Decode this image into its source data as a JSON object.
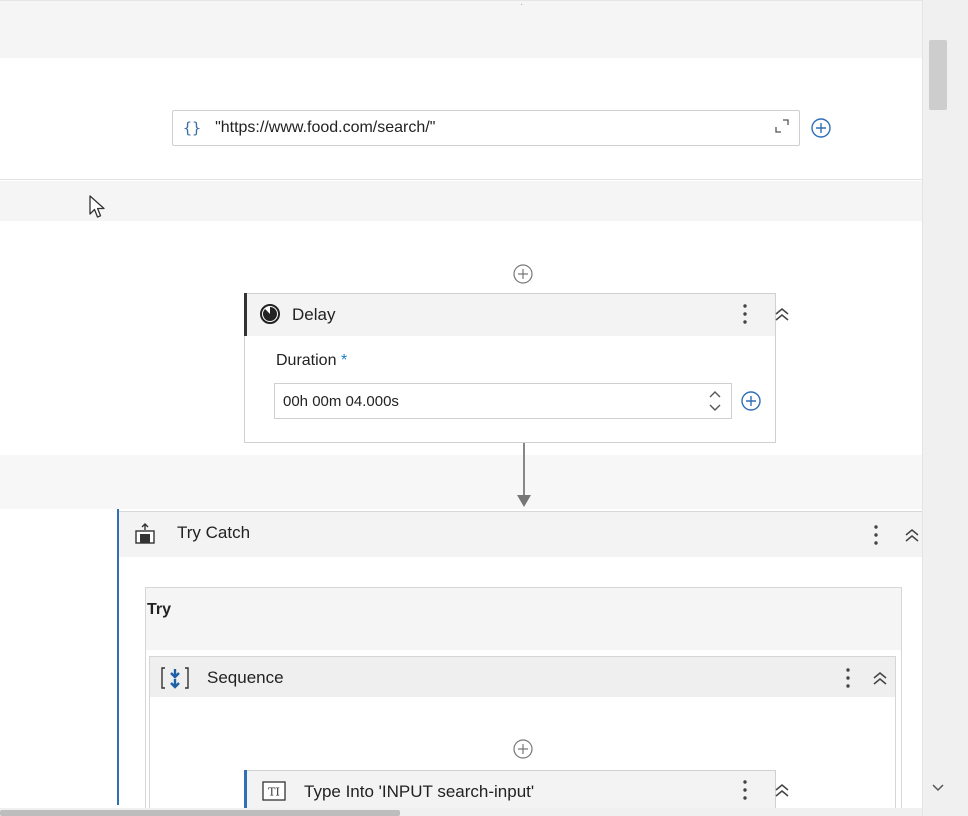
{
  "url_field": {
    "braces": "{}",
    "value": "\"https://www.food.com/search/\""
  },
  "delay": {
    "title": "Delay",
    "duration_label": "Duration",
    "required_mark": "*",
    "duration_value": "00h 00m 04.000s"
  },
  "try_catch": {
    "title": "Try Catch",
    "try_label": "Try"
  },
  "sequence": {
    "title": "Sequence"
  },
  "type_into": {
    "title": "Type Into 'INPUT  search-input'",
    "icon_text": "TI"
  },
  "colors": {
    "accent": "#2f6fb6",
    "required": "#1a7fc4",
    "card_header": "#f3f3f3"
  },
  "icons": [
    "expand-icon",
    "add-circle-icon",
    "mouse-cursor-icon",
    "delay-clock-icon",
    "more-vertical-icon",
    "collapse-chevrons-icon",
    "spinner-updown-icon",
    "connector-arrow-icon",
    "try-catch-icon",
    "sequence-icon",
    "type-into-icon",
    "scroll-down-icon"
  ]
}
